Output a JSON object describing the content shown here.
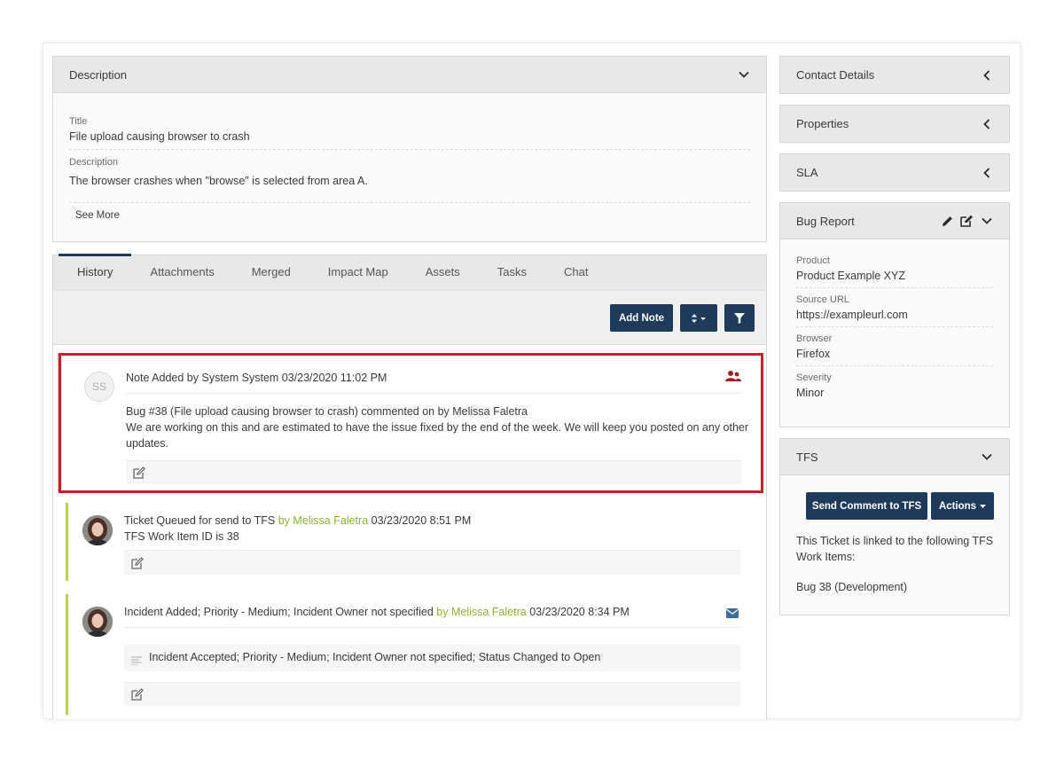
{
  "description_panel": {
    "header": "Description",
    "title_label": "Title",
    "title_value": "File upload causing browser to crash",
    "desc_label": "Description",
    "desc_value": "The browser crashes when \"browse\" is selected from area A.",
    "see_more": "See More"
  },
  "tabs": [
    "History",
    "Attachments",
    "Merged",
    "Impact Map",
    "Assets",
    "Tasks",
    "Chat"
  ],
  "toolbar": {
    "add_note": "Add Note",
    "sort_icon": "sort-icon",
    "filter_icon": "filter-icon"
  },
  "entries": [
    {
      "avatar_initials": "SS",
      "title": "Note Added by System System 03/23/2020 11:02 PM",
      "line1": "Bug #38 (File upload causing browser to crash) commented on by Melissa Faletra",
      "line2a": "We are working on this and are estimated to have the issue fixed by the end of the week. We will keep you posted on any other",
      "line2b": "updates.",
      "icon": "users-icon"
    },
    {
      "title_prefix": "Ticket Queued for send to TFS",
      "title_by": "by Melissa Faletra",
      "title_time": "03/23/2020 8:51 PM",
      "line1": "TFS Work Item ID is 38"
    },
    {
      "title_prefix": "Incident Added; Priority - Medium; Incident Owner not specified",
      "title_by": "by Melissa Faletra",
      "title_time": "03/23/2020 8:34 PM",
      "sub": "Incident Accepted; Priority - Medium; Incident Owner not specified; Status Changed to Open",
      "icon": "envelope-icon"
    }
  ],
  "right": {
    "contact": "Contact Details",
    "properties": "Properties",
    "sla": "SLA",
    "bug_report": {
      "header": "Bug Report",
      "fields": [
        {
          "label": "Product",
          "value": "Product Example XYZ"
        },
        {
          "label": "Source URL",
          "value": "https://exampleurl.com"
        },
        {
          "label": "Browser",
          "value": "Firefox"
        },
        {
          "label": "Severity",
          "value": "Minor"
        }
      ]
    },
    "tfs": {
      "header": "TFS",
      "send_btn": "Send Comment to TFS",
      "actions_btn": "Actions",
      "linked_text_a": "This Ticket is linked to the following TFS",
      "linked_text_b": "Work Items:",
      "item": "Bug 38 (Development)"
    }
  },
  "colors": {
    "navy": "#1f3b5c",
    "highlight": "#c8202f",
    "accent_green": "#bcd34a",
    "user_link": "#8cb236"
  }
}
